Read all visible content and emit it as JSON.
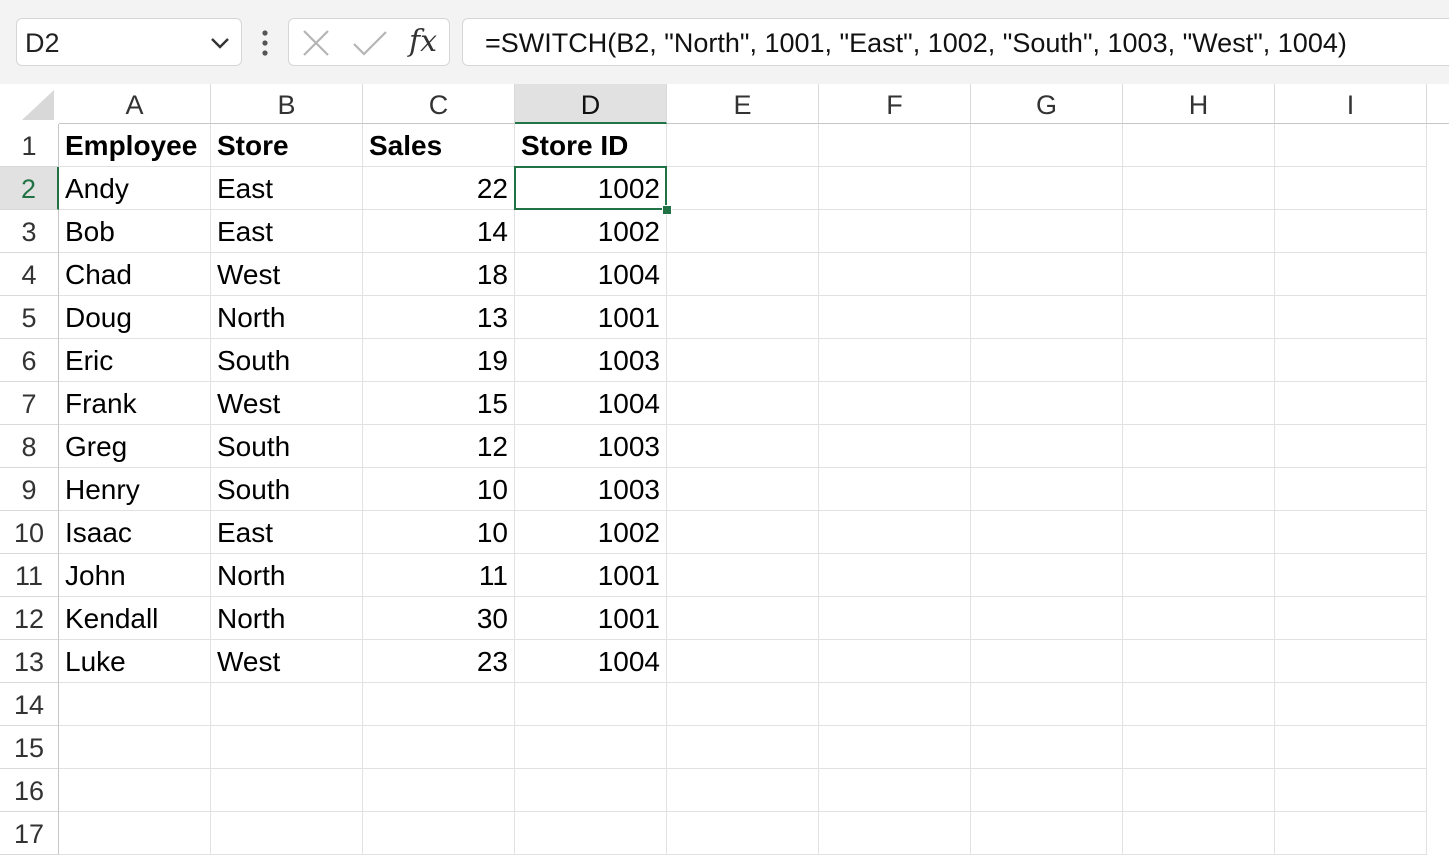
{
  "formula_bar": {
    "name_box": "D2",
    "formula": "=SWITCH(B2, \"North\", 1001, \"East\", 1002, \"South\", 1003, \"West\", 1004)",
    "fx_label": "fx",
    "icons": [
      "chevron-down-icon",
      "more-vertical-icon",
      "cancel-icon",
      "enter-check-icon",
      "insert-function-icon"
    ]
  },
  "grid": {
    "columns": [
      "A",
      "B",
      "C",
      "D",
      "E",
      "F",
      "G",
      "H",
      "I"
    ],
    "row_numbers": [
      "1",
      "2",
      "3",
      "4",
      "5",
      "6",
      "7",
      "8",
      "9",
      "10",
      "11",
      "12",
      "13",
      "14",
      "15",
      "16",
      "17"
    ],
    "selected_cell": "D2",
    "accent_color": "#217346",
    "headers": [
      "Employee",
      "Store",
      "Sales",
      "Store ID"
    ],
    "rows": [
      [
        "Andy",
        "East",
        "22",
        "1002"
      ],
      [
        "Bob",
        "East",
        "14",
        "1002"
      ],
      [
        "Chad",
        "West",
        "18",
        "1004"
      ],
      [
        "Doug",
        "North",
        "13",
        "1001"
      ],
      [
        "Eric",
        "South",
        "19",
        "1003"
      ],
      [
        "Frank",
        "West",
        "15",
        "1004"
      ],
      [
        "Greg",
        "South",
        "12",
        "1003"
      ],
      [
        "Henry",
        "South",
        "10",
        "1003"
      ],
      [
        "Isaac",
        "East",
        "10",
        "1002"
      ],
      [
        "John",
        "North",
        "11",
        "1001"
      ],
      [
        "Kendall",
        "North",
        "30",
        "1001"
      ],
      [
        "Luke",
        "West",
        "23",
        "1004"
      ]
    ]
  }
}
